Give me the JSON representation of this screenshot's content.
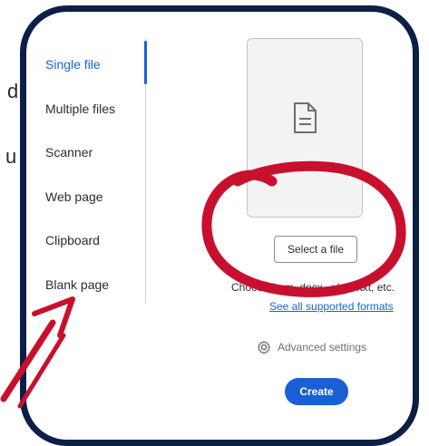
{
  "background": {
    "fragment_top": "d",
    "fragment_mid": "u"
  },
  "sidebar": {
    "items": [
      {
        "label": "Single file",
        "active": true
      },
      {
        "label": "Multiple files",
        "active": false
      },
      {
        "label": "Scanner",
        "active": false
      },
      {
        "label": "Web page",
        "active": false
      },
      {
        "label": "Clipboard",
        "active": false
      },
      {
        "label": "Blank page",
        "active": false
      }
    ]
  },
  "main": {
    "file_icon": "document-icon",
    "select_button": "Select a file",
    "choose_text": "Choose from .docx, .xlsx, .txt, etc.",
    "formats_link": "See all supported formats",
    "advanced_settings": "Advanced settings",
    "create_button": "Create"
  },
  "colors": {
    "accent": "#1a62d6",
    "frame": "#0b1f47",
    "annotation": "#c8102e"
  }
}
